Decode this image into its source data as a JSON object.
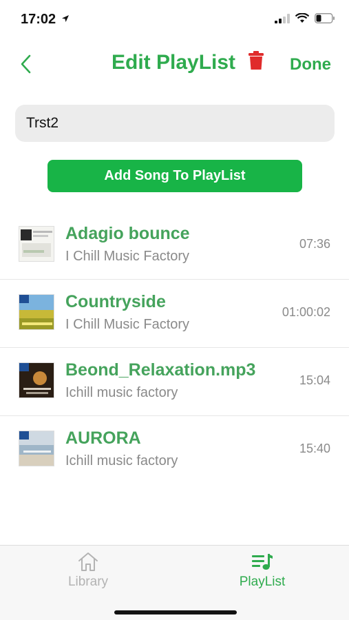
{
  "status_bar": {
    "time": "17:02",
    "icons": [
      "location-arrow-icon",
      "cellular-signal-icon",
      "wifi-icon",
      "battery-icon"
    ]
  },
  "nav": {
    "title": "Edit PlayList",
    "done_label": "Done",
    "icons": {
      "back": "chevron-left-icon",
      "delete": "trash-icon"
    }
  },
  "playlist_name": {
    "value": "Trst2"
  },
  "add_song_label": "Add Song To PlayList",
  "songs": [
    {
      "title": "Adagio bounce",
      "artist": "I Chill Music Factory",
      "duration": "07:36"
    },
    {
      "title": "Countryside",
      "artist": "I Chill Music Factory",
      "duration": "01:00:02"
    },
    {
      "title": "Beond_Relaxation.mp3",
      "artist": "Ichill music factory",
      "duration": "15:04"
    },
    {
      "title": "AURORA",
      "artist": "Ichill music factory",
      "duration": "15:40"
    }
  ],
  "tabs": [
    {
      "label": "Library",
      "icon": "home-icon",
      "active": false
    },
    {
      "label": "PlayList",
      "icon": "playlist-icon",
      "active": true
    }
  ],
  "colors": {
    "accent": "#2fab4e",
    "button": "#18b447",
    "delete": "#e02b2b",
    "inactive": "#b3b3b3"
  }
}
